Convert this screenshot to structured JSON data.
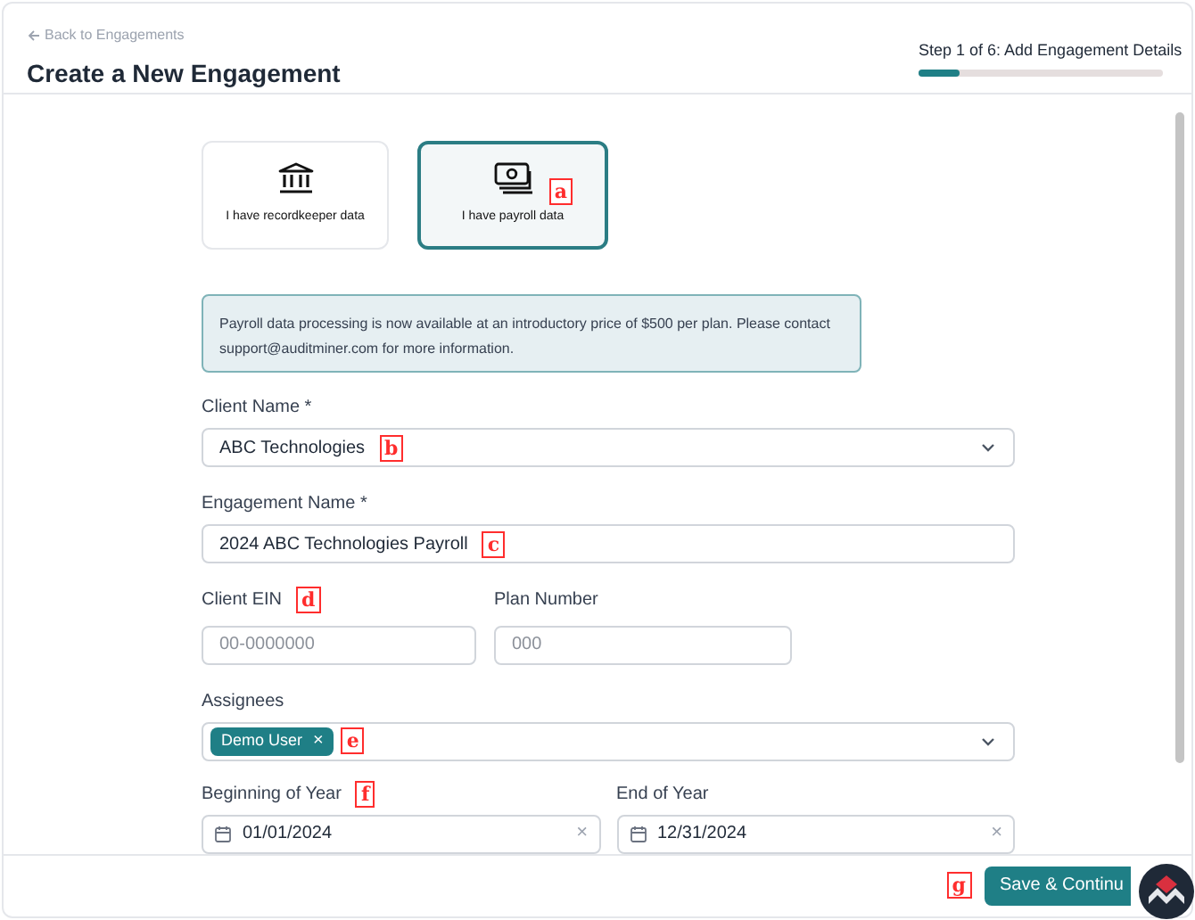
{
  "header": {
    "back_link": "Back to Engagements",
    "title": "Create a New Engagement",
    "step": {
      "label": "Step 1 of 6: Add Engagement Details",
      "level": 0.167
    }
  },
  "data_options": [
    {
      "kind": "bank",
      "label": "I have recordkeeper data",
      "selected": false
    },
    {
      "kind": "money",
      "label": "I have payroll data",
      "selected": true,
      "callout": "a"
    }
  ],
  "notice": "Payroll data processing is now available at an introductory price of $500 per plan. Please contact support@auditminer.com for more information.",
  "client_name": {
    "label": "Client Name *",
    "value": "ABC Technologies",
    "callout": "b"
  },
  "engagement_name": {
    "label": "Engagement Name *",
    "value": "2024 ABC Technologies Payroll",
    "callout": "c"
  },
  "client_ein": {
    "label": "Client EIN",
    "placeholder": "00-0000000",
    "label_callout": "d"
  },
  "plan_number": {
    "label": "Plan Number",
    "placeholder": "000"
  },
  "assignees": {
    "label": "Assignees",
    "tags": [
      "Demo User"
    ],
    "tag_remove": "×",
    "callout": "e"
  },
  "beginning_of_year": {
    "label": "Beginning of Year",
    "value": "01/01/2024",
    "clear": "×",
    "label_callout": "f"
  },
  "end_of_year": {
    "label": "End of Year",
    "value": "12/31/2024",
    "clear": "×"
  },
  "footer": {
    "button": "Save & Continu",
    "callout": "g"
  }
}
